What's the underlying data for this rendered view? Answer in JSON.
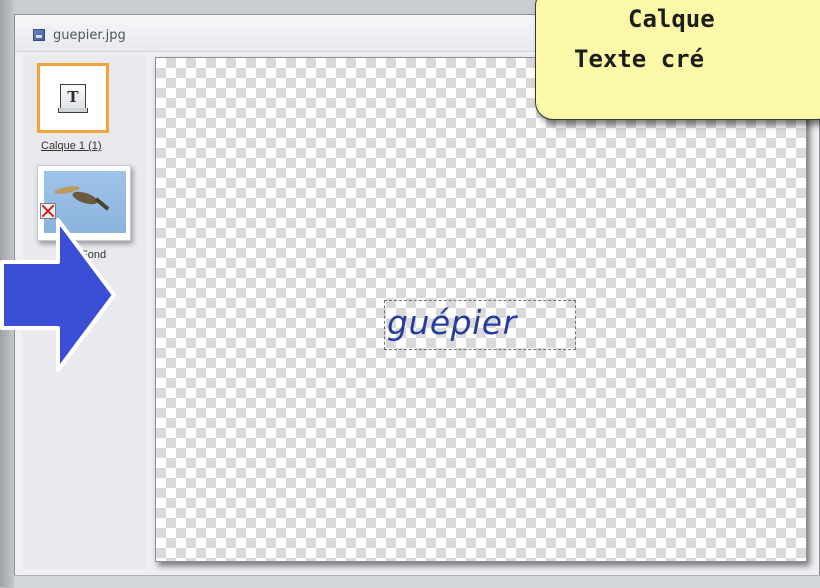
{
  "window": {
    "title": "guepier.jpg"
  },
  "layers": [
    {
      "label": "Calque 1 (1)",
      "icon": "text-layer-icon",
      "selected": true
    },
    {
      "label": "Fond",
      "icon": "photo-thumbnail",
      "visible": false
    }
  ],
  "canvas": {
    "text": "guépier",
    "text_color": "#263d9e"
  },
  "callout": {
    "line1": "Calque",
    "line2": "Texte cré",
    "background": "#fbf9a8"
  },
  "arrow": {
    "color": "#3b4fd6",
    "icon": "arrow-right-icon"
  },
  "colors": {
    "selection_border": "#f3a33b",
    "hidden_marker": "#d41b1b"
  }
}
